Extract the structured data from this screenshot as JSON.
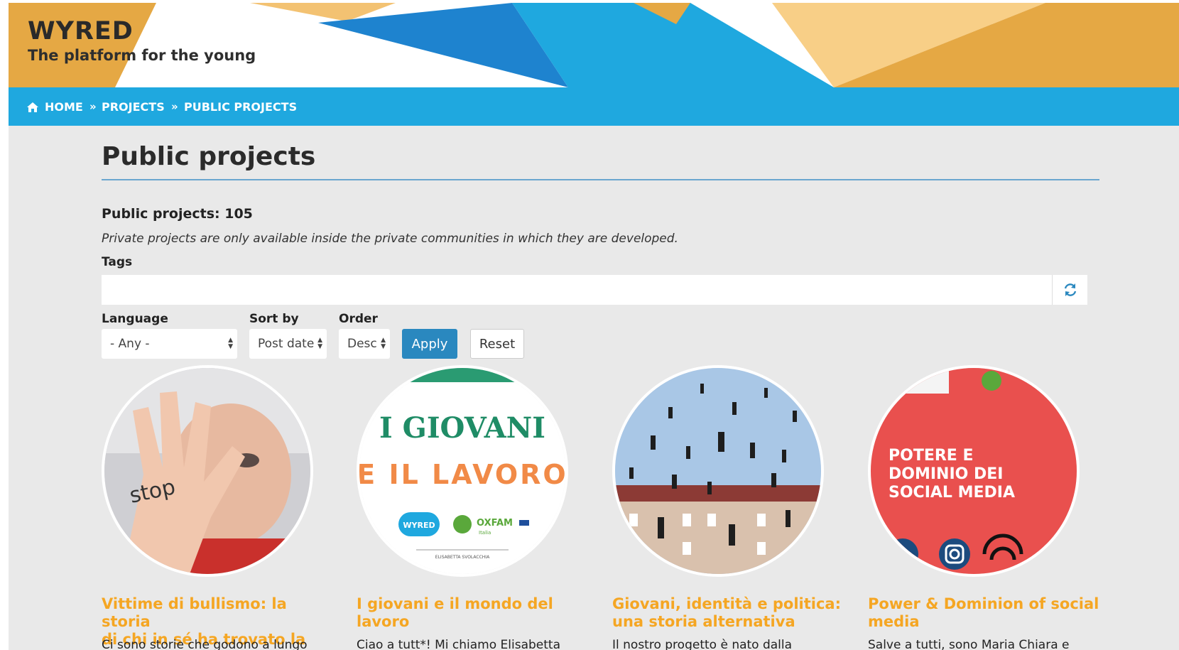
{
  "header": {
    "brand": "WYRED",
    "tagline": "The platform for the young"
  },
  "breadcrumb": [
    "HOME",
    "PROJECTS",
    "PUBLIC PROJECTS"
  ],
  "page": {
    "title": "Public projects",
    "count_text": "Public projects: 105",
    "note": "Private projects are only available inside the private communities in which they are developed."
  },
  "filters": {
    "tags_label": "Tags",
    "tags_value": "",
    "language_label": "Language",
    "language_value": "- Any -",
    "sortby_label": "Sort by",
    "sortby_value": "Post date",
    "order_label": "Order",
    "order_value": "Desc",
    "apply_label": "Apply",
    "reset_label": "Reset"
  },
  "cards": [
    {
      "title_line1": "Vittime di bullismo: la storia",
      "title_line2": "di chi in sé ha trovato la luce",
      "excerpt": "Ci sono storie che godono a lungo",
      "image_text": "stop"
    },
    {
      "title_line1": "I giovani e il mondo del",
      "title_line2": "lavoro",
      "excerpt": "Ciao a tutt*! Mi chiamo Elisabetta",
      "image_text": {
        "headline": "I GIOVANI",
        "subline": "E IL LAVORO",
        "logo1": "WYRED",
        "logo2": "OXFAM",
        "logo2_sub": "Italia",
        "footer": "ELISABETTA SVOLACCHIA"
      }
    },
    {
      "title_line1": "Giovani, identità e politica:",
      "title_line2": "una storia alternativa",
      "excerpt": "Il nostro progetto è nato dalla"
    },
    {
      "title_line1": "Power & Dominion of social",
      "title_line2": "media",
      "excerpt": "Salve a tutti, sono Maria Chiara e",
      "image_text": {
        "line1": "POTERE E",
        "line2": "DOMINIO DEI",
        "line3": "SOCIAL MEDIA"
      }
    }
  ],
  "colors": {
    "brand_gold": "#e5a844",
    "brand_light_gold": "#f8cf87",
    "brand_blue": "#1fa8df",
    "brand_dark_blue": "#1e83cf",
    "title_orange": "#f5a623",
    "button_blue": "#2a88bf"
  }
}
